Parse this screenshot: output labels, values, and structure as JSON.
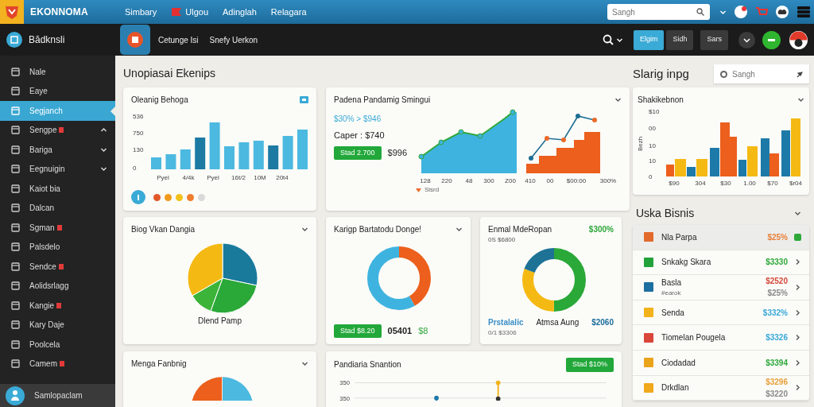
{
  "topbar": {
    "brand": "EKONNOMA",
    "nav": [
      {
        "label": "Simbary",
        "kind": "text"
      },
      {
        "label": "Ulgou",
        "kind": "icon"
      },
      {
        "label": "Adinglah",
        "kind": "text"
      },
      {
        "label": "Relagara",
        "kind": "text"
      }
    ],
    "search": {
      "placeholder": "Sangh"
    }
  },
  "subbar": {
    "sidebar_title": "Bădknsli",
    "links": [
      "Cetunge Isi",
      "Snefy Uerkon"
    ],
    "buttons": [
      {
        "label": "Elgim",
        "selected": true
      },
      {
        "label": "Sidh",
        "selected": false
      },
      {
        "label": "Sars",
        "selected": false
      }
    ]
  },
  "sidebar": {
    "items": [
      {
        "label": "Nale",
        "selected": false,
        "badge": false
      },
      {
        "label": "Eaye",
        "selected": false,
        "badge": false
      },
      {
        "label": "Segjanch",
        "selected": true,
        "badge": false
      },
      {
        "label": "Sengpe",
        "selected": false,
        "badge": true,
        "expanded": true
      },
      {
        "label": "Bariga",
        "selected": false,
        "badge": false,
        "expanded": false
      },
      {
        "label": "Eegnuigin",
        "selected": false,
        "badge": false,
        "expanded": false
      },
      {
        "label": "Kaiot bia",
        "selected": false,
        "badge": false
      },
      {
        "label": "Dalcan",
        "selected": false,
        "badge": false
      },
      {
        "label": "Sgman",
        "selected": false,
        "badge": true
      },
      {
        "label": "Palsdelo",
        "selected": false,
        "badge": false
      },
      {
        "label": "Sendce",
        "selected": false,
        "badge": true
      },
      {
        "label": "Aolidsrlagg",
        "selected": false,
        "badge": false
      },
      {
        "label": "Kangie",
        "selected": false,
        "badge": true
      },
      {
        "label": "Kary Daje",
        "selected": false,
        "badge": false
      },
      {
        "label": "Poolcela",
        "selected": false,
        "badge": false
      },
      {
        "label": "Camem",
        "selected": false,
        "badge": true
      }
    ],
    "footer": "Samlopaclam"
  },
  "main": {
    "title": "Unopiasai Ekenips",
    "card_bars": {
      "title": "Oleanig Behoga",
      "y_labels": [
        "536",
        "750",
        "130",
        "0"
      ],
      "x_labels": [
        "Pyel",
        "4/4k",
        "Pyel",
        "16t/2",
        "10M",
        "20t4"
      ],
      "dots": [
        {
          "color": "#e2582a"
        },
        {
          "color": "#f09a1c"
        },
        {
          "color": "#f2c21a"
        },
        {
          "color": "#ef7d2e"
        },
        {
          "color": "#d9d9d9"
        }
      ]
    },
    "card_trend": {
      "title": "Padena Pandamig Smingui",
      "change": "$30% > $946",
      "caption": "Caper : $740",
      "badge": "Stad 2.700",
      "amount": "$996",
      "x_labels_1": [
        "128",
        "220",
        "48",
        "300",
        "Z00"
      ],
      "x_labels_2": [
        "410",
        "00",
        "$00:00",
        "300%"
      ],
      "legend": "Sisrd"
    },
    "card_pie": {
      "title": "Biog Vkan Dangia",
      "label": "Dlend Pamp"
    },
    "card_donut": {
      "title": "Karigp Bartatodu Donge!",
      "badge": "Stad $8.20",
      "value": "05401",
      "delta": "$8"
    },
    "card_donut2": {
      "title": "Enmal MdeRopan",
      "change": "$300%",
      "subtitle": "0S $6800",
      "name_1": "Prstalalic",
      "sub_1": "0/1 $3306",
      "name_2": "Atmsa Aung",
      "amount": "$2060"
    },
    "card_pie2": {
      "title": "Menga Fanbnig"
    },
    "card_lollipop": {
      "title": "Pandiaria Snantion",
      "badge": "Stad $10%",
      "y_labels": [
        "350",
        "350"
      ]
    }
  },
  "side_panel": {
    "title": "Slarig inpg",
    "search": {
      "placeholder": "Sangh"
    },
    "chart": {
      "title": "Shakikebnon",
      "ylabel": "Bezh",
      "y_labels": [
        "$10",
        "00",
        "10",
        "10",
        "0"
      ],
      "x_labels": [
        "$90",
        "304",
        "$30",
        "1.00",
        "$70",
        "$r04"
      ]
    },
    "list_title": "Uska Bisnis",
    "items": [
      {
        "name": "Nla Parpa",
        "amount": {
          "text": "$25%",
          "color": "#e8803a"
        },
        "color": "#e26a2c",
        "selected": true
      },
      {
        "name": "Snkakg Skara",
        "amount": {
          "text": "$3330",
          "color": "#2ea83a"
        },
        "color": "#22a23a",
        "selected": false
      },
      {
        "name": "Basla",
        "sub": "#earok",
        "amount": {
          "text": "$2520",
          "color": "#d44a3a"
        },
        "amount_2": "$25%",
        "color": "#1d6fa0",
        "selected": false
      },
      {
        "name": "Senda",
        "amount": {
          "text": "$332%",
          "color": "#3aa8d8"
        },
        "color": "#f2b21c",
        "selected": false
      },
      {
        "name": "Tiomelan Pougela",
        "amount": {
          "text": "$3326",
          "color": "#3aa8d8"
        },
        "color": "#d9473a",
        "selected": false
      },
      {
        "name": "Ciodadad",
        "amount": {
          "text": "$3394",
          "color": "#2ea83a"
        },
        "color": "#eaa41c",
        "selected": false
      },
      {
        "name": "Drkdlan",
        "amount": {
          "text": "$3296",
          "color": "#e8a03a"
        },
        "amount_2": "$3220",
        "color": "#f0a81c",
        "selected": false
      }
    ]
  }
}
